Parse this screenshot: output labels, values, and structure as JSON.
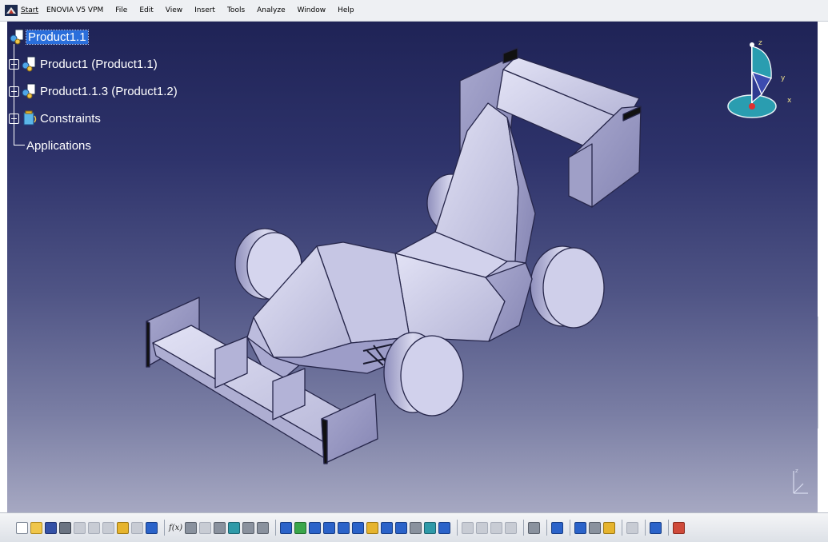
{
  "menubar": {
    "items": [
      "Start",
      "ENOVIA V5 VPM",
      "File",
      "Edit",
      "View",
      "Insert",
      "Tools",
      "Analyze",
      "Window",
      "Help"
    ]
  },
  "tree": {
    "root": "Product1.1",
    "children": [
      "Product1 (Product1.1)",
      "Product1.1.3 (Product1.2)",
      "Constraints",
      "Applications"
    ]
  },
  "compass": {
    "axis_x": "x",
    "axis_y": "y",
    "axis_z": "z"
  },
  "toolbar": {
    "formula_label": "f(x)"
  },
  "colors": {
    "background_top": "#1f2356",
    "background_bottom": "#a6a8c2",
    "part_face": "#c9c9e6",
    "selection": "#2a6edb"
  },
  "icons": [
    "product-icon",
    "expander-icon",
    "constraints-icon",
    "compass-icon",
    "new-icon",
    "open-icon",
    "save-icon",
    "print-icon",
    "formula-icon",
    "fit-all-icon",
    "zoom-in-icon",
    "zoom-out-icon",
    "pan-icon",
    "rotate-icon"
  ]
}
